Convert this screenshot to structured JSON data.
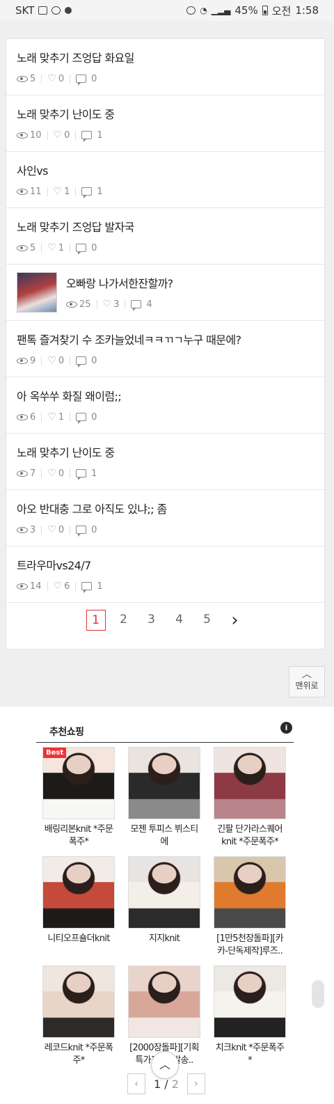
{
  "status": {
    "carrier": "SKT",
    "battery": "45%",
    "ampm": "오전",
    "time": "1:58"
  },
  "posts": [
    {
      "title": "노래 맞추기 즈엉답 화요일",
      "views": "5",
      "likes": "0",
      "comments": "0"
    },
    {
      "title": "노래 맞추기 난이도 중",
      "views": "10",
      "likes": "0",
      "comments": "1"
    },
    {
      "title": "사인vs",
      "views": "11",
      "likes": "1",
      "comments": "1"
    },
    {
      "title": "노래 맞추기 즈엉답 발자국",
      "views": "5",
      "likes": "1",
      "comments": "0"
    },
    {
      "title": "오빠랑 나가서한잔할까?",
      "views": "25",
      "likes": "3",
      "comments": "4",
      "has_image": true
    },
    {
      "title": "팬톡 즐겨찾기 수 조카늘었네ㅋㅋㄲㄱ누구 때문에?",
      "views": "9",
      "likes": "0",
      "comments": "0"
    },
    {
      "title": "아 옥쑤쑤 화질 왜이럼;;",
      "views": "6",
      "likes": "1",
      "comments": "0"
    },
    {
      "title": "노래 맞추기 난이도 중",
      "views": "7",
      "likes": "0",
      "comments": "1"
    },
    {
      "title": "아오 반대충 그로 아직도 있냐;; 좀",
      "views": "3",
      "likes": "0",
      "comments": "0"
    },
    {
      "title": "트라우마vs24/7",
      "views": "14",
      "likes": "6",
      "comments": "1"
    }
  ],
  "pagination": {
    "pages": [
      "1",
      "2",
      "3",
      "4",
      "5"
    ],
    "current": "1",
    "next": "›"
  },
  "top_button": {
    "label": "맨위로",
    "arrow": "︿"
  },
  "recommend": {
    "title": "추천쇼핑",
    "info": "i",
    "best_badge": "Best",
    "products": [
      {
        "name": "배링리본knit *주문폭주*",
        "colors": [
          "#f4e6dc",
          "#1d1a1a",
          "#f7f7f5"
        ]
      },
      {
        "name": "모젠 투피스 뷔스티에",
        "colors": [
          "#e9e4e0",
          "#2a2a2a",
          "#8a8a8a"
        ]
      },
      {
        "name": "긴팔 단가라스퀘어knit *주문폭주*",
        "colors": [
          "#efe5e0",
          "#8e3a45",
          "#b9848a"
        ]
      },
      {
        "name": "니티오프숄더knit",
        "colors": [
          "#f2ece9",
          "#c44a3a",
          "#1e1b1b"
        ]
      },
      {
        "name": "지지knit",
        "colors": [
          "#e8e4e1",
          "#f3efe8",
          "#2b2b2b"
        ]
      },
      {
        "name": "[1만5천장돌파][카카-단독제작]루즈..",
        "colors": [
          "#d9c7ad",
          "#e07a2f",
          "#4a4a4a"
        ]
      },
      {
        "name": "레코드knit *주문폭주*",
        "colors": [
          "#f0e6e0",
          "#e9d4c8",
          "#2f2a2a"
        ]
      },
      {
        "name": "[2000장돌파][기획특가][당일발송..",
        "colors": [
          "#e8d4cb",
          "#d7a89a",
          "#f1e6e1"
        ]
      },
      {
        "name": "치크knit *주문폭주*",
        "colors": [
          "#ece8e4",
          "#f6f3ee",
          "#222222"
        ]
      }
    ],
    "page": {
      "current": "1",
      "sep": "/",
      "total": "2"
    }
  }
}
